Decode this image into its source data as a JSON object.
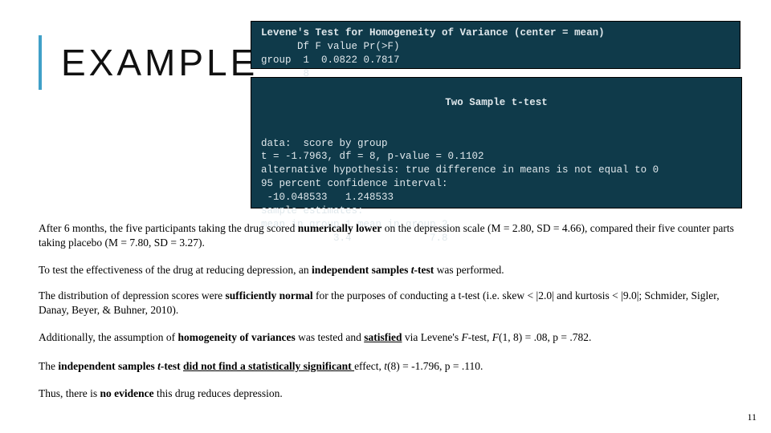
{
  "title": "EXAMPLE",
  "levene": {
    "header": "Levene's Test for Homogeneity of Variance (center = mean)",
    "row_header": "      Df F value Pr(>F)",
    "row1": "group  1  0.0822 0.7817",
    "row2": "       8"
  },
  "ttest": {
    "title": "Two Sample t-test",
    "l1": "data:  score by group",
    "l2": "t = -1.7963, df = 8, p-value = 0.1102",
    "l3": "alternative hypothesis: true difference in means is not equal to 0",
    "l4": "95 percent confidence interval:",
    "l5": " -10.048533   1.248533",
    "l6": "sample estimates:",
    "l7": "mean in group 1 mean in group 2",
    "l8": "            3.4             7.8"
  },
  "para1": {
    "a": "After 6 months, the five participants taking the drug scored ",
    "b": "numerically lower",
    "c": " on the depression scale (M = 2.80, SD = 4.66), compared their five counter parts taking placebo (M = 7.80, SD = 3.27)."
  },
  "para2": {
    "a": "To test the effectiveness of the drug at reducing depression, an ",
    "b": "independent samples ",
    "f": "t",
    "g": "-test",
    "c": " was performed."
  },
  "para3": {
    "a": " The distribution of depression scores were ",
    "b": "sufficiently normal",
    "c": " for the purposes of conducting a t-test (i.e. skew < |2.0| and kurtosis < |9.0|; Schmider, Sigler, Danay, Beyer, & Buhner, 2010)."
  },
  "para4": {
    "a": "Additionally, the assumption of ",
    "b": "homogeneity of variances",
    "c": " was tested and ",
    "d": "satisfied",
    "e": " via Levene's ",
    "f": "F",
    "g": "-test, ",
    "h": "F",
    "i": "(1, 8) = .08, p = .782."
  },
  "para5": {
    "a": "The ",
    "b": "independent samples ",
    "f": "t",
    "g": "-test ",
    "c": "did not find a statistically significant ",
    "d": "effect, ",
    "h": "t",
    "e": "(8) = -1.796, p = .110."
  },
  "para6": {
    "a": "Thus, there is ",
    "b": "no evidence ",
    "c": "this drug reduces depression."
  },
  "page_number": "11"
}
